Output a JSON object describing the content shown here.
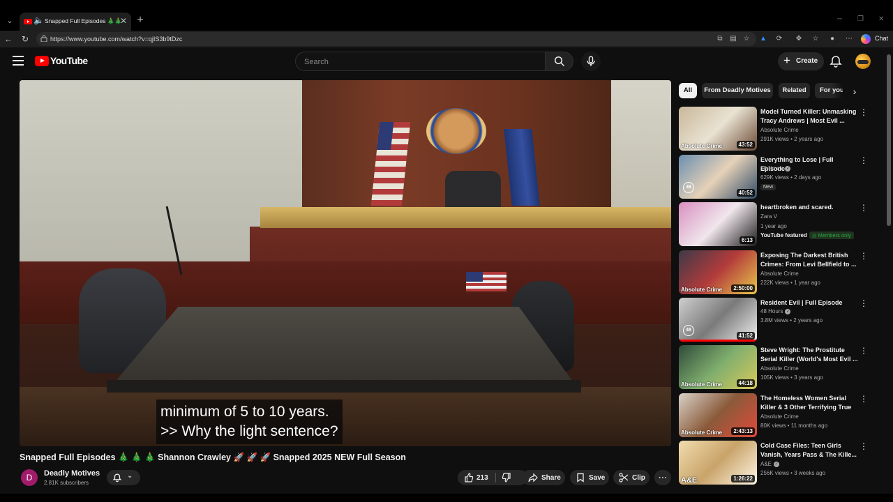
{
  "browser": {
    "tab_title": "Snapped Full Episodes 🎄🎄",
    "url": "https://www.youtube.com/watch?v=qjIS3b9tDzc",
    "chat_label": "Chat"
  },
  "youtube": {
    "logo_text": "YouTube",
    "search_placeholder": "Search",
    "create_label": "Create"
  },
  "player": {
    "caption_line_1": "minimum of 5 to 10 years.",
    "caption_line_2": ">> Why the light sentence?"
  },
  "video": {
    "title": "Snapped Full Episodes 🎄 🎄 🎄 Shannon Crawley 🚀 🚀 🚀 Snapped 2025 NEW Full Season",
    "channel_initial": "D",
    "channel_name": "Deadly Motives",
    "subscribers": "2.81K subscribers",
    "likes": "213",
    "share_label": "Share",
    "save_label": "Save",
    "clip_label": "Clip"
  },
  "chips": [
    "All",
    "From Deadly Motives",
    "Related",
    "For you"
  ],
  "recommendations": [
    {
      "title": "Model Turned Killer: Unmasking Tracy Andrews | Most Evil ...",
      "channel": "Absolute Crime",
      "meta": "291K views • 2 years ago",
      "duration": "43:52",
      "badge": "Absolute Crime",
      "thumb_colors": [
        "#c9b79a",
        "#e9e2d2",
        "#6b4a35"
      ]
    },
    {
      "title": "Everything to Lose | Full Episode",
      "channel": "48 Hours",
      "meta": "629K views • 2 days ago",
      "duration": "40:52",
      "badge": "48",
      "tag": "New",
      "thumb_colors": [
        "#6a8fb0",
        "#e6d1b8",
        "#2e4a66"
      ]
    },
    {
      "title": "heartbroken and scared.",
      "channel": "Zara V",
      "meta": "1 year ago",
      "duration": "6:13",
      "featured": "YouTube featured",
      "members": "Members only",
      "thumb_colors": [
        "#d88fc0",
        "#f0e6ec",
        "#1b1b1b"
      ]
    },
    {
      "title": "Exposing The Darkest British Crimes: From Levi Bellfield to ...",
      "channel": "Absolute Crime",
      "meta": "222K views • 1 year ago",
      "duration": "2:50:00",
      "badge": "Absolute Crime",
      "thumb_colors": [
        "#3e3a48",
        "#b23b3b",
        "#e9c84a"
      ]
    },
    {
      "title": "Resident Evil | Full Episode",
      "channel": "48 Hours",
      "meta": "3.8M views • 2 years ago",
      "duration": "41:52",
      "badge": "48",
      "thumb_colors": [
        "#cfcfcf",
        "#7a7a7a",
        "#f2f2f2"
      ]
    },
    {
      "title": "Steve Wright: The Prostitute Serial Killer (World's Most Evil ...",
      "channel": "Absolute Crime",
      "meta": "105K views • 3 years ago",
      "duration": "44:18",
      "badge": "Absolute Crime",
      "thumb_colors": [
        "#2f4a3a",
        "#7fae6e",
        "#d8c95a"
      ]
    },
    {
      "title": "The Homeless Women Serial Killer & 3 Other Terrifying True ...",
      "channel": "Absolute Crime",
      "meta": "80K views • 11 months ago",
      "duration": "2:43:13",
      "badge": "Absolute Crime",
      "thumb_colors": [
        "#d9d2c8",
        "#8a5a3a",
        "#e24a3a"
      ]
    },
    {
      "title": "Cold Case Files: Teen Girls Vanish, Years Pass & The Kille...",
      "channel": "A&E",
      "meta": "256K views • 3 weeks ago",
      "duration": "1:26:22",
      "badge": "A&E",
      "thumb_colors": [
        "#f1dcae",
        "#c9a46a",
        "#fff7e6"
      ]
    }
  ]
}
